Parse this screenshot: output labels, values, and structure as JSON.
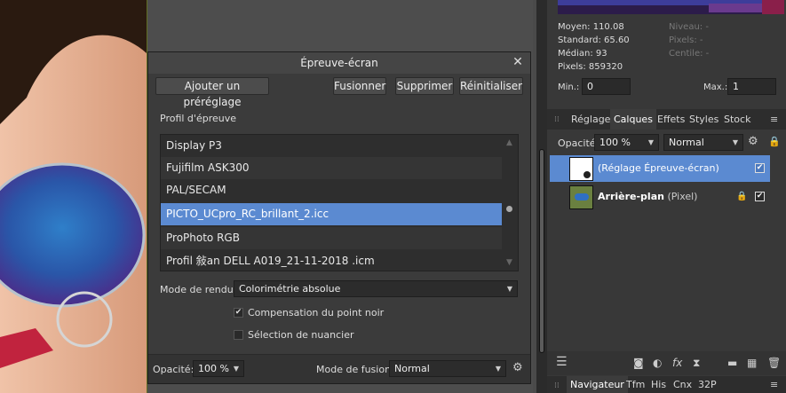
{
  "dialog": {
    "title": "Épreuve-écran",
    "buttons": {
      "add_preset": "Ajouter un préréglage",
      "merge": "Fusionner",
      "delete": "Supprimer",
      "reset": "Réinitialiser"
    },
    "profile_label": "Profil d'épreuve",
    "profiles": [
      "Display P3",
      "Fujifilm ASK300",
      "PAL/SECAM",
      "PICTO_UCpro_RC_brillant_2.icc",
      "ProPhoto RGB",
      "Profil 敍an DELL A019_21-11-2018 .icm"
    ],
    "selected_profile_index": 3,
    "render_mode_label": "Mode de rendu:",
    "render_mode_value": "Colorimétrie absolue",
    "black_point_label": "Compensation du point noir",
    "black_point_checked": true,
    "swatch_label": "Sélection de nuancier",
    "swatch_checked": false,
    "opacity_label": "Opacité:",
    "opacity_value": "100 %",
    "blend_label": "Mode de fusion:",
    "blend_value": "Normal"
  },
  "histogram": {
    "mean": "Moyen: 110.08",
    "std": "Standard: 65.60",
    "median": "Médian: 93",
    "pixels": "Pixels: 859320",
    "level": "Niveau: -",
    "pixels_dim": "Pixels: -",
    "percentile": "Centile: -",
    "min_label": "Min.:",
    "min_value": "0",
    "max_label": "Max.:",
    "max_value": "1"
  },
  "panel_tabs": [
    "Réglage",
    "Calques",
    "Effets",
    "Styles",
    "Stock"
  ],
  "active_panel_tab": "Calques",
  "layers_toolbar": {
    "opacity_label": "Opacité:",
    "opacity_value": "100 %",
    "blend_value": "Normal"
  },
  "layers": [
    {
      "name": "(Réglage Épreuve-écran)",
      "type": "",
      "selected": true,
      "checked": true
    },
    {
      "name": "Arrière-plan",
      "type": " (Pixel)",
      "selected": false,
      "checked": true
    }
  ],
  "nav_tabs": [
    "Navigateur",
    "Tfm",
    "His",
    "Cnx",
    "32P"
  ],
  "active_nav_tab": "Navigateur"
}
